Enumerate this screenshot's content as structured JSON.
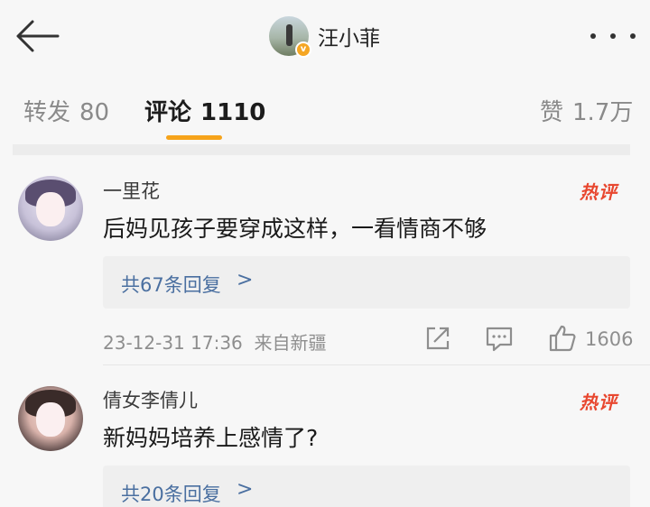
{
  "header": {
    "author_name": "汪小菲",
    "verified_badge": "v",
    "back_icon": "back-arrow-icon",
    "more_icon": "more-dots-icon"
  },
  "tabs": {
    "repost_label": "转发",
    "repost_count": "80",
    "comment_label": "评论",
    "comment_count": "1110",
    "like_label": "赞",
    "like_count": "1.7万",
    "active": "comment",
    "accent_color": "#f6a31a"
  },
  "comments": [
    {
      "username": "一里花",
      "hot_label": "热评",
      "text": "后妈见孩子要穿成这样，一看情商不够",
      "replies_label": "共67条回复",
      "reply_arrow": ">",
      "timestamp": "23-12-31 17:36",
      "location": "来自新疆",
      "like_count": "1606"
    },
    {
      "username": "倩女李倩儿",
      "hot_label": "热评",
      "text": "新妈妈培养上感情了?",
      "replies_label": "共20条回复",
      "reply_arrow": ">"
    }
  ],
  "colors": {
    "hot_tag": "#e8472f",
    "reply_link": "#4a6fa0",
    "meta_text": "#8e8e8e"
  }
}
